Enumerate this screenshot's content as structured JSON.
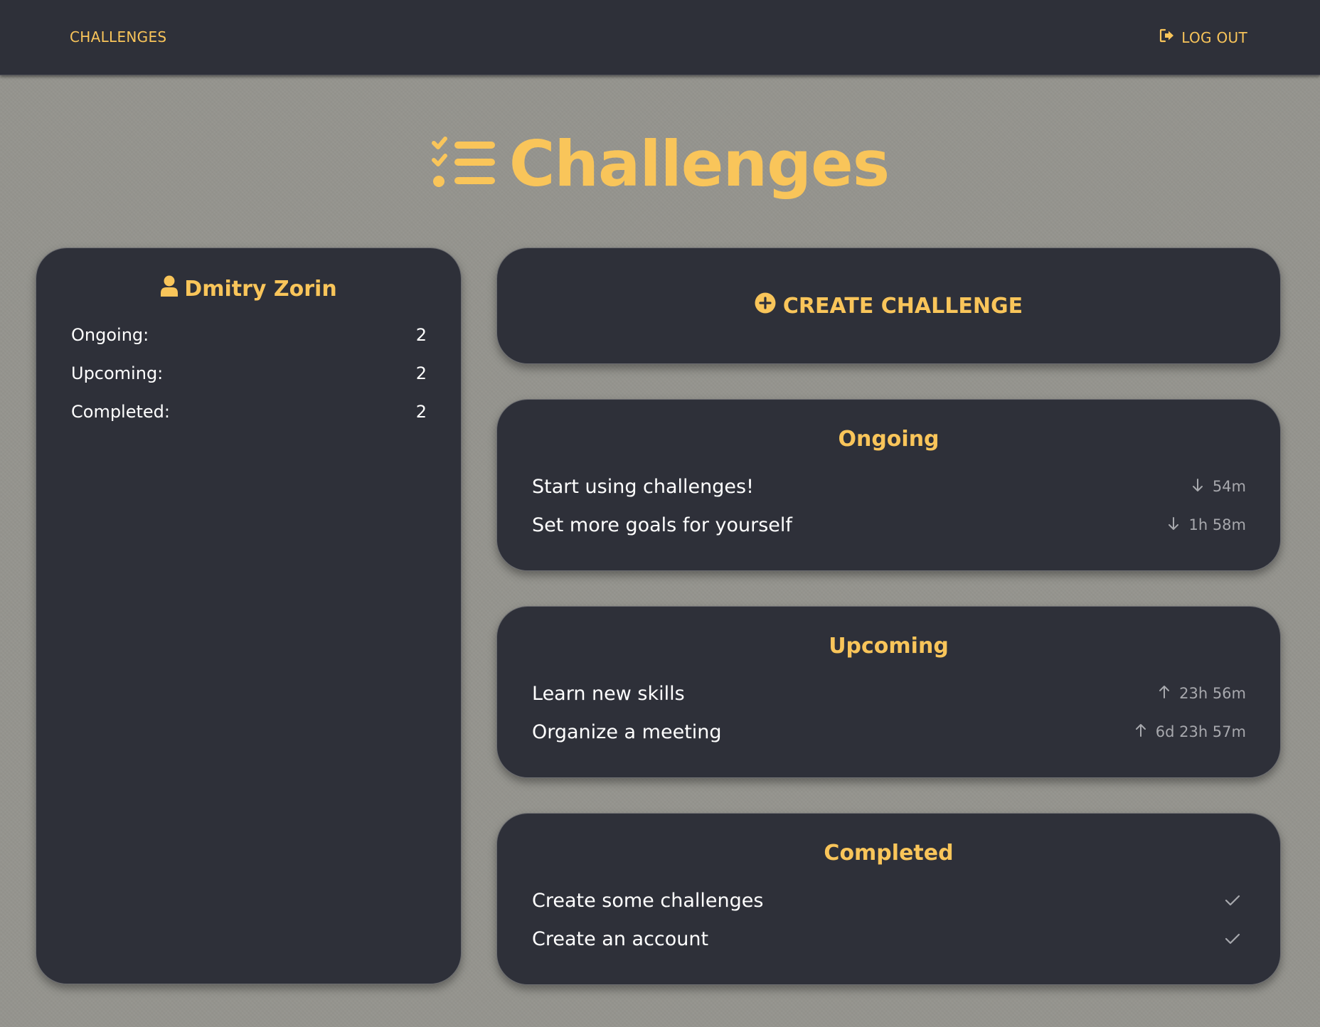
{
  "nav": {
    "brand": "CHALLENGES",
    "logout_label": "LOG OUT"
  },
  "page": {
    "title": "Challenges"
  },
  "profile": {
    "name": "Dmitry Zorin",
    "stats": [
      {
        "label": "Ongoing:",
        "value": "2"
      },
      {
        "label": "Upcoming:",
        "value": "2"
      },
      {
        "label": "Completed:",
        "value": "2"
      }
    ]
  },
  "create_button": {
    "label": "CREATE CHALLENGE"
  },
  "sections": {
    "ongoing": {
      "title": "Ongoing",
      "items": [
        {
          "label": "Start using challenges!",
          "time": "54m",
          "icon": "arrow-down-icon"
        },
        {
          "label": "Set more goals for yourself",
          "time": "1h 58m",
          "icon": "arrow-down-icon"
        }
      ]
    },
    "upcoming": {
      "title": "Upcoming",
      "items": [
        {
          "label": "Learn new skills",
          "time": "23h 56m",
          "icon": "arrow-up-icon"
        },
        {
          "label": "Organize a meeting",
          "time": "6d 23h 57m",
          "icon": "arrow-up-icon"
        }
      ]
    },
    "completed": {
      "title": "Completed",
      "items": [
        {
          "label": "Create some challenges",
          "icon": "checkmark-icon"
        },
        {
          "label": "Create an account",
          "icon": "checkmark-icon"
        }
      ]
    }
  },
  "colors": {
    "accent": "#f9c55a",
    "card_bg": "#2e3039",
    "page_bg": "#95948e",
    "muted_text": "#a7a8ad"
  }
}
